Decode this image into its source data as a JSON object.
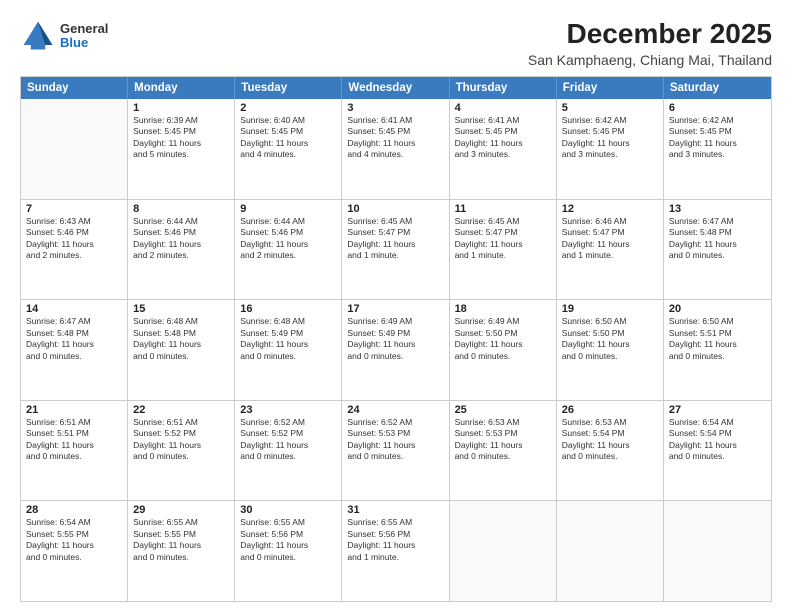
{
  "header": {
    "logo_general": "General",
    "logo_blue": "Blue",
    "main_title": "December 2025",
    "subtitle": "San Kamphaeng, Chiang Mai, Thailand"
  },
  "weekdays": [
    "Sunday",
    "Monday",
    "Tuesday",
    "Wednesday",
    "Thursday",
    "Friday",
    "Saturday"
  ],
  "rows": [
    [
      {
        "day": "",
        "lines": []
      },
      {
        "day": "1",
        "lines": [
          "Sunrise: 6:39 AM",
          "Sunset: 5:45 PM",
          "Daylight: 11 hours",
          "and 5 minutes."
        ]
      },
      {
        "day": "2",
        "lines": [
          "Sunrise: 6:40 AM",
          "Sunset: 5:45 PM",
          "Daylight: 11 hours",
          "and 4 minutes."
        ]
      },
      {
        "day": "3",
        "lines": [
          "Sunrise: 6:41 AM",
          "Sunset: 5:45 PM",
          "Daylight: 11 hours",
          "and 4 minutes."
        ]
      },
      {
        "day": "4",
        "lines": [
          "Sunrise: 6:41 AM",
          "Sunset: 5:45 PM",
          "Daylight: 11 hours",
          "and 3 minutes."
        ]
      },
      {
        "day": "5",
        "lines": [
          "Sunrise: 6:42 AM",
          "Sunset: 5:45 PM",
          "Daylight: 11 hours",
          "and 3 minutes."
        ]
      },
      {
        "day": "6",
        "lines": [
          "Sunrise: 6:42 AM",
          "Sunset: 5:45 PM",
          "Daylight: 11 hours",
          "and 3 minutes."
        ]
      }
    ],
    [
      {
        "day": "7",
        "lines": [
          "Sunrise: 6:43 AM",
          "Sunset: 5:46 PM",
          "Daylight: 11 hours",
          "and 2 minutes."
        ]
      },
      {
        "day": "8",
        "lines": [
          "Sunrise: 6:44 AM",
          "Sunset: 5:46 PM",
          "Daylight: 11 hours",
          "and 2 minutes."
        ]
      },
      {
        "day": "9",
        "lines": [
          "Sunrise: 6:44 AM",
          "Sunset: 5:46 PM",
          "Daylight: 11 hours",
          "and 2 minutes."
        ]
      },
      {
        "day": "10",
        "lines": [
          "Sunrise: 6:45 AM",
          "Sunset: 5:47 PM",
          "Daylight: 11 hours",
          "and 1 minute."
        ]
      },
      {
        "day": "11",
        "lines": [
          "Sunrise: 6:45 AM",
          "Sunset: 5:47 PM",
          "Daylight: 11 hours",
          "and 1 minute."
        ]
      },
      {
        "day": "12",
        "lines": [
          "Sunrise: 6:46 AM",
          "Sunset: 5:47 PM",
          "Daylight: 11 hours",
          "and 1 minute."
        ]
      },
      {
        "day": "13",
        "lines": [
          "Sunrise: 6:47 AM",
          "Sunset: 5:48 PM",
          "Daylight: 11 hours",
          "and 0 minutes."
        ]
      }
    ],
    [
      {
        "day": "14",
        "lines": [
          "Sunrise: 6:47 AM",
          "Sunset: 5:48 PM",
          "Daylight: 11 hours",
          "and 0 minutes."
        ]
      },
      {
        "day": "15",
        "lines": [
          "Sunrise: 6:48 AM",
          "Sunset: 5:48 PM",
          "Daylight: 11 hours",
          "and 0 minutes."
        ]
      },
      {
        "day": "16",
        "lines": [
          "Sunrise: 6:48 AM",
          "Sunset: 5:49 PM",
          "Daylight: 11 hours",
          "and 0 minutes."
        ]
      },
      {
        "day": "17",
        "lines": [
          "Sunrise: 6:49 AM",
          "Sunset: 5:49 PM",
          "Daylight: 11 hours",
          "and 0 minutes."
        ]
      },
      {
        "day": "18",
        "lines": [
          "Sunrise: 6:49 AM",
          "Sunset: 5:50 PM",
          "Daylight: 11 hours",
          "and 0 minutes."
        ]
      },
      {
        "day": "19",
        "lines": [
          "Sunrise: 6:50 AM",
          "Sunset: 5:50 PM",
          "Daylight: 11 hours",
          "and 0 minutes."
        ]
      },
      {
        "day": "20",
        "lines": [
          "Sunrise: 6:50 AM",
          "Sunset: 5:51 PM",
          "Daylight: 11 hours",
          "and 0 minutes."
        ]
      }
    ],
    [
      {
        "day": "21",
        "lines": [
          "Sunrise: 6:51 AM",
          "Sunset: 5:51 PM",
          "Daylight: 11 hours",
          "and 0 minutes."
        ]
      },
      {
        "day": "22",
        "lines": [
          "Sunrise: 6:51 AM",
          "Sunset: 5:52 PM",
          "Daylight: 11 hours",
          "and 0 minutes."
        ]
      },
      {
        "day": "23",
        "lines": [
          "Sunrise: 6:52 AM",
          "Sunset: 5:52 PM",
          "Daylight: 11 hours",
          "and 0 minutes."
        ]
      },
      {
        "day": "24",
        "lines": [
          "Sunrise: 6:52 AM",
          "Sunset: 5:53 PM",
          "Daylight: 11 hours",
          "and 0 minutes."
        ]
      },
      {
        "day": "25",
        "lines": [
          "Sunrise: 6:53 AM",
          "Sunset: 5:53 PM",
          "Daylight: 11 hours",
          "and 0 minutes."
        ]
      },
      {
        "day": "26",
        "lines": [
          "Sunrise: 6:53 AM",
          "Sunset: 5:54 PM",
          "Daylight: 11 hours",
          "and 0 minutes."
        ]
      },
      {
        "day": "27",
        "lines": [
          "Sunrise: 6:54 AM",
          "Sunset: 5:54 PM",
          "Daylight: 11 hours",
          "and 0 minutes."
        ]
      }
    ],
    [
      {
        "day": "28",
        "lines": [
          "Sunrise: 6:54 AM",
          "Sunset: 5:55 PM",
          "Daylight: 11 hours",
          "and 0 minutes."
        ]
      },
      {
        "day": "29",
        "lines": [
          "Sunrise: 6:55 AM",
          "Sunset: 5:55 PM",
          "Daylight: 11 hours",
          "and 0 minutes."
        ]
      },
      {
        "day": "30",
        "lines": [
          "Sunrise: 6:55 AM",
          "Sunset: 5:56 PM",
          "Daylight: 11 hours",
          "and 0 minutes."
        ]
      },
      {
        "day": "31",
        "lines": [
          "Sunrise: 6:55 AM",
          "Sunset: 5:56 PM",
          "Daylight: 11 hours",
          "and 1 minute."
        ]
      },
      {
        "day": "",
        "lines": []
      },
      {
        "day": "",
        "lines": []
      },
      {
        "day": "",
        "lines": []
      }
    ]
  ]
}
